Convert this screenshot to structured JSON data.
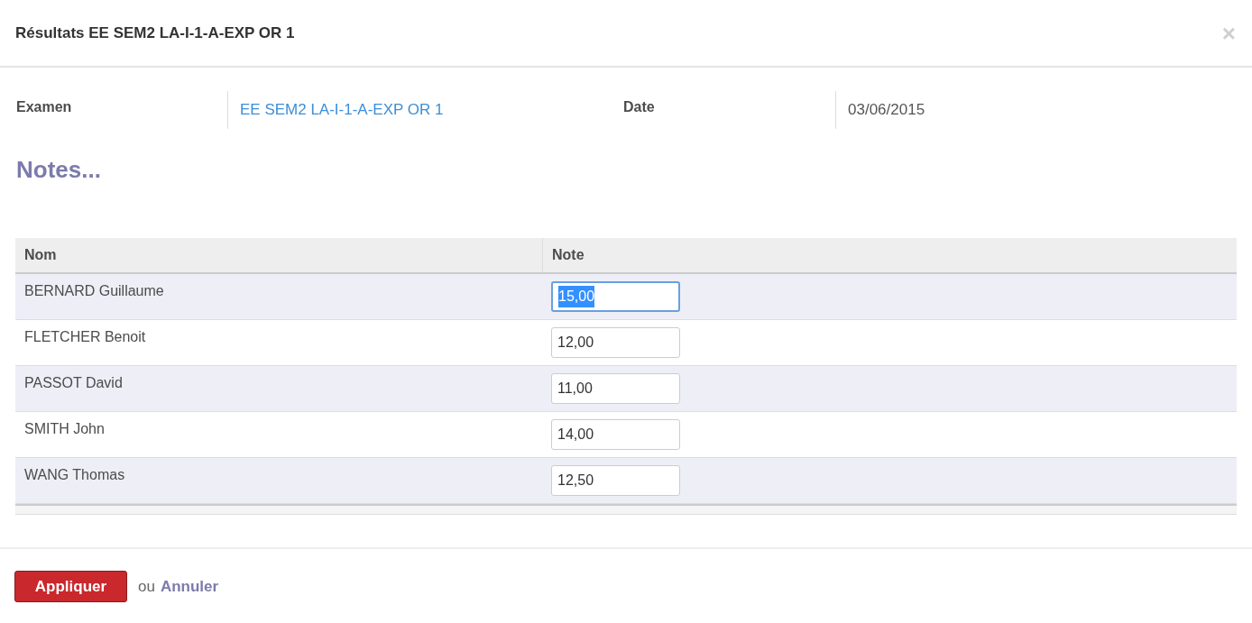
{
  "dialog": {
    "title": "Résultats EE SEM2 LA-I-1-A-EXP OR 1",
    "close": "×"
  },
  "fields": [
    {
      "label": "Examen",
      "value": "EE SEM2 LA-I-1-A-EXP OR 1",
      "kind": "link"
    },
    {
      "label": "Date",
      "value": "03/06/2015",
      "kind": "text"
    }
  ],
  "section_title": "Notes...",
  "table": {
    "columns": [
      "Nom",
      "Note"
    ],
    "rows": [
      {
        "name": "BERNARD Guillaume",
        "note": "15,00",
        "focused": true
      },
      {
        "name": "FLETCHER Benoit",
        "note": "12,00",
        "focused": false
      },
      {
        "name": "PASSOT David",
        "note": "11,00",
        "focused": false
      },
      {
        "name": "SMITH John",
        "note": "14,00",
        "focused": false
      },
      {
        "name": "WANG Thomas",
        "note": "12,50",
        "focused": false
      }
    ]
  },
  "footer": {
    "apply": "Appliquer",
    "or": "ou",
    "cancel": "Annuler"
  }
}
